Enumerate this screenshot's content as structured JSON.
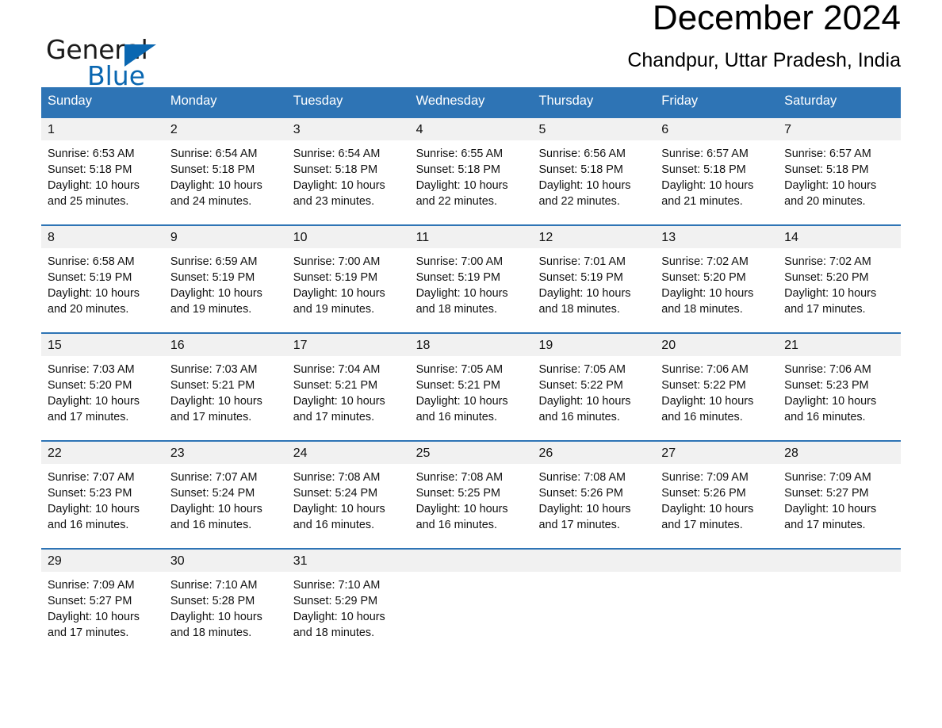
{
  "brand": {
    "name_part1": "General",
    "name_part2": "Blue",
    "accent_color": "#0a67b1"
  },
  "header": {
    "title": "December 2024",
    "subtitle": "Chandpur, Uttar Pradesh, India",
    "header_bg_color": "#2e74b5",
    "day_band_color": "#f1f1f1"
  },
  "weekdays": [
    "Sunday",
    "Monday",
    "Tuesday",
    "Wednesday",
    "Thursday",
    "Friday",
    "Saturday"
  ],
  "weeks": [
    [
      {
        "day": "1",
        "sunrise": "Sunrise: 6:53 AM",
        "sunset": "Sunset: 5:18 PM",
        "daylight_1": "Daylight: 10 hours",
        "daylight_2": "and 25 minutes."
      },
      {
        "day": "2",
        "sunrise": "Sunrise: 6:54 AM",
        "sunset": "Sunset: 5:18 PM",
        "daylight_1": "Daylight: 10 hours",
        "daylight_2": "and 24 minutes."
      },
      {
        "day": "3",
        "sunrise": "Sunrise: 6:54 AM",
        "sunset": "Sunset: 5:18 PM",
        "daylight_1": "Daylight: 10 hours",
        "daylight_2": "and 23 minutes."
      },
      {
        "day": "4",
        "sunrise": "Sunrise: 6:55 AM",
        "sunset": "Sunset: 5:18 PM",
        "daylight_1": "Daylight: 10 hours",
        "daylight_2": "and 22 minutes."
      },
      {
        "day": "5",
        "sunrise": "Sunrise: 6:56 AM",
        "sunset": "Sunset: 5:18 PM",
        "daylight_1": "Daylight: 10 hours",
        "daylight_2": "and 22 minutes."
      },
      {
        "day": "6",
        "sunrise": "Sunrise: 6:57 AM",
        "sunset": "Sunset: 5:18 PM",
        "daylight_1": "Daylight: 10 hours",
        "daylight_2": "and 21 minutes."
      },
      {
        "day": "7",
        "sunrise": "Sunrise: 6:57 AM",
        "sunset": "Sunset: 5:18 PM",
        "daylight_1": "Daylight: 10 hours",
        "daylight_2": "and 20 minutes."
      }
    ],
    [
      {
        "day": "8",
        "sunrise": "Sunrise: 6:58 AM",
        "sunset": "Sunset: 5:19 PM",
        "daylight_1": "Daylight: 10 hours",
        "daylight_2": "and 20 minutes."
      },
      {
        "day": "9",
        "sunrise": "Sunrise: 6:59 AM",
        "sunset": "Sunset: 5:19 PM",
        "daylight_1": "Daylight: 10 hours",
        "daylight_2": "and 19 minutes."
      },
      {
        "day": "10",
        "sunrise": "Sunrise: 7:00 AM",
        "sunset": "Sunset: 5:19 PM",
        "daylight_1": "Daylight: 10 hours",
        "daylight_2": "and 19 minutes."
      },
      {
        "day": "11",
        "sunrise": "Sunrise: 7:00 AM",
        "sunset": "Sunset: 5:19 PM",
        "daylight_1": "Daylight: 10 hours",
        "daylight_2": "and 18 minutes."
      },
      {
        "day": "12",
        "sunrise": "Sunrise: 7:01 AM",
        "sunset": "Sunset: 5:19 PM",
        "daylight_1": "Daylight: 10 hours",
        "daylight_2": "and 18 minutes."
      },
      {
        "day": "13",
        "sunrise": "Sunrise: 7:02 AM",
        "sunset": "Sunset: 5:20 PM",
        "daylight_1": "Daylight: 10 hours",
        "daylight_2": "and 18 minutes."
      },
      {
        "day": "14",
        "sunrise": "Sunrise: 7:02 AM",
        "sunset": "Sunset: 5:20 PM",
        "daylight_1": "Daylight: 10 hours",
        "daylight_2": "and 17 minutes."
      }
    ],
    [
      {
        "day": "15",
        "sunrise": "Sunrise: 7:03 AM",
        "sunset": "Sunset: 5:20 PM",
        "daylight_1": "Daylight: 10 hours",
        "daylight_2": "and 17 minutes."
      },
      {
        "day": "16",
        "sunrise": "Sunrise: 7:03 AM",
        "sunset": "Sunset: 5:21 PM",
        "daylight_1": "Daylight: 10 hours",
        "daylight_2": "and 17 minutes."
      },
      {
        "day": "17",
        "sunrise": "Sunrise: 7:04 AM",
        "sunset": "Sunset: 5:21 PM",
        "daylight_1": "Daylight: 10 hours",
        "daylight_2": "and 17 minutes."
      },
      {
        "day": "18",
        "sunrise": "Sunrise: 7:05 AM",
        "sunset": "Sunset: 5:21 PM",
        "daylight_1": "Daylight: 10 hours",
        "daylight_2": "and 16 minutes."
      },
      {
        "day": "19",
        "sunrise": "Sunrise: 7:05 AM",
        "sunset": "Sunset: 5:22 PM",
        "daylight_1": "Daylight: 10 hours",
        "daylight_2": "and 16 minutes."
      },
      {
        "day": "20",
        "sunrise": "Sunrise: 7:06 AM",
        "sunset": "Sunset: 5:22 PM",
        "daylight_1": "Daylight: 10 hours",
        "daylight_2": "and 16 minutes."
      },
      {
        "day": "21",
        "sunrise": "Sunrise: 7:06 AM",
        "sunset": "Sunset: 5:23 PM",
        "daylight_1": "Daylight: 10 hours",
        "daylight_2": "and 16 minutes."
      }
    ],
    [
      {
        "day": "22",
        "sunrise": "Sunrise: 7:07 AM",
        "sunset": "Sunset: 5:23 PM",
        "daylight_1": "Daylight: 10 hours",
        "daylight_2": "and 16 minutes."
      },
      {
        "day": "23",
        "sunrise": "Sunrise: 7:07 AM",
        "sunset": "Sunset: 5:24 PM",
        "daylight_1": "Daylight: 10 hours",
        "daylight_2": "and 16 minutes."
      },
      {
        "day": "24",
        "sunrise": "Sunrise: 7:08 AM",
        "sunset": "Sunset: 5:24 PM",
        "daylight_1": "Daylight: 10 hours",
        "daylight_2": "and 16 minutes."
      },
      {
        "day": "25",
        "sunrise": "Sunrise: 7:08 AM",
        "sunset": "Sunset: 5:25 PM",
        "daylight_1": "Daylight: 10 hours",
        "daylight_2": "and 16 minutes."
      },
      {
        "day": "26",
        "sunrise": "Sunrise: 7:08 AM",
        "sunset": "Sunset: 5:26 PM",
        "daylight_1": "Daylight: 10 hours",
        "daylight_2": "and 17 minutes."
      },
      {
        "day": "27",
        "sunrise": "Sunrise: 7:09 AM",
        "sunset": "Sunset: 5:26 PM",
        "daylight_1": "Daylight: 10 hours",
        "daylight_2": "and 17 minutes."
      },
      {
        "day": "28",
        "sunrise": "Sunrise: 7:09 AM",
        "sunset": "Sunset: 5:27 PM",
        "daylight_1": "Daylight: 10 hours",
        "daylight_2": "and 17 minutes."
      }
    ],
    [
      {
        "day": "29",
        "sunrise": "Sunrise: 7:09 AM",
        "sunset": "Sunset: 5:27 PM",
        "daylight_1": "Daylight: 10 hours",
        "daylight_2": "and 17 minutes."
      },
      {
        "day": "30",
        "sunrise": "Sunrise: 7:10 AM",
        "sunset": "Sunset: 5:28 PM",
        "daylight_1": "Daylight: 10 hours",
        "daylight_2": "and 18 minutes."
      },
      {
        "day": "31",
        "sunrise": "Sunrise: 7:10 AM",
        "sunset": "Sunset: 5:29 PM",
        "daylight_1": "Daylight: 10 hours",
        "daylight_2": "and 18 minutes."
      },
      {
        "day": "",
        "sunrise": "",
        "sunset": "",
        "daylight_1": "",
        "daylight_2": ""
      },
      {
        "day": "",
        "sunrise": "",
        "sunset": "",
        "daylight_1": "",
        "daylight_2": ""
      },
      {
        "day": "",
        "sunrise": "",
        "sunset": "",
        "daylight_1": "",
        "daylight_2": ""
      },
      {
        "day": "",
        "sunrise": "",
        "sunset": "",
        "daylight_1": "",
        "daylight_2": ""
      }
    ]
  ]
}
